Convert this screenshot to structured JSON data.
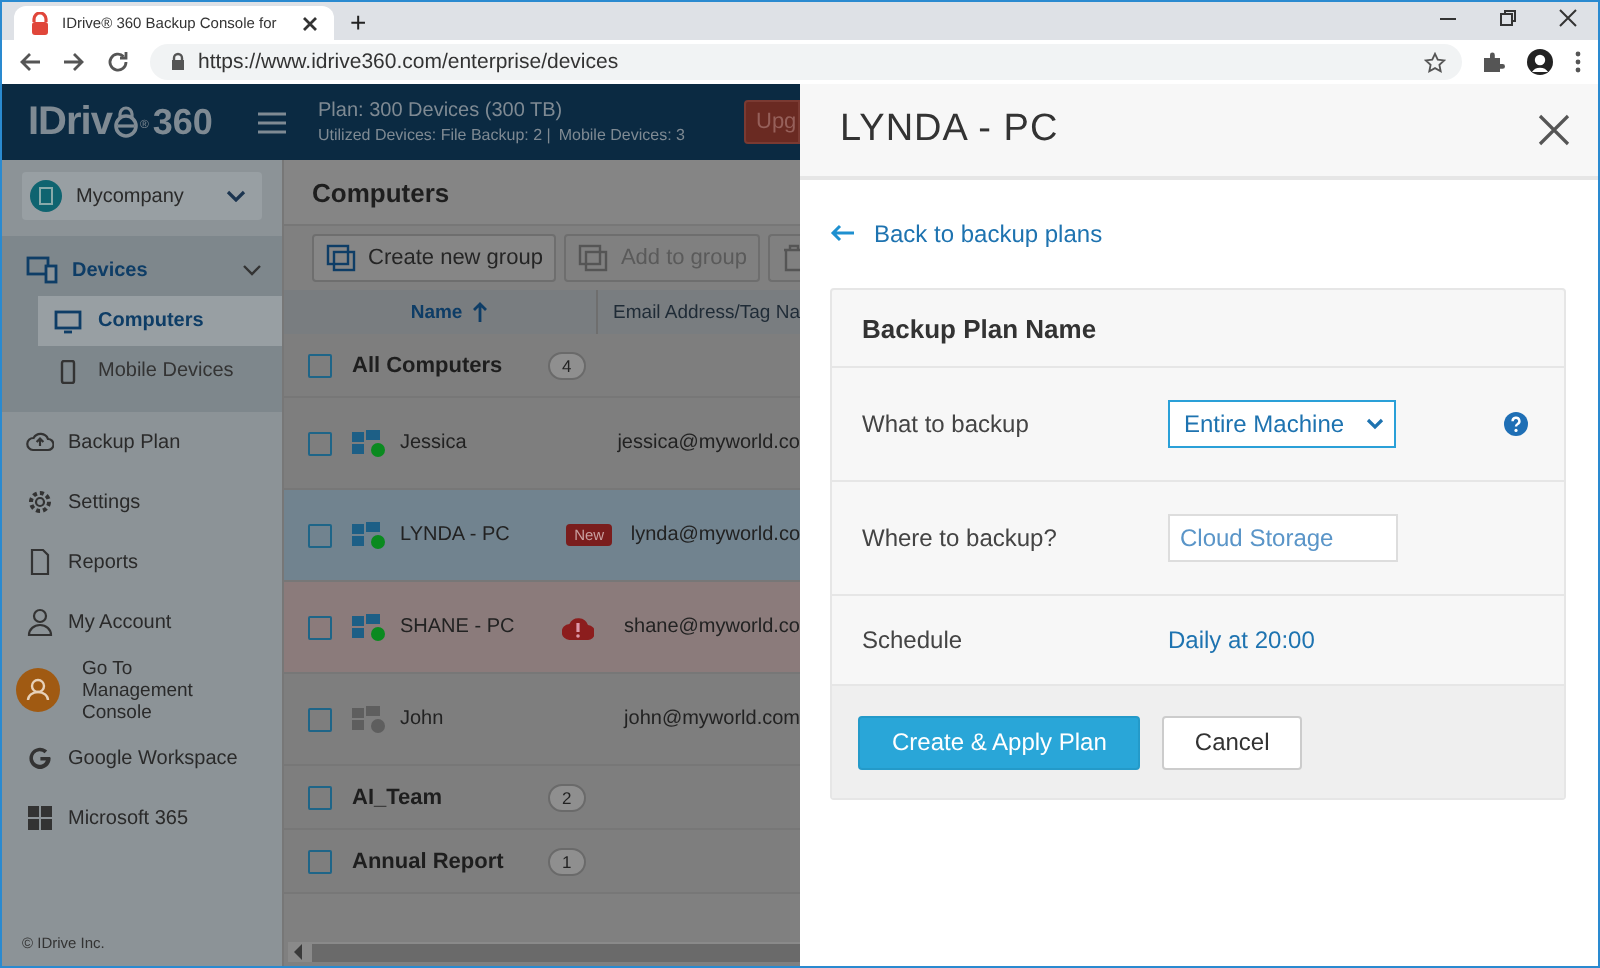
{
  "browser": {
    "tab_title": "IDrive® 360 Backup Console for",
    "new_tab": "+",
    "url": "https://www.idrive360.com/enterprise/devices"
  },
  "header": {
    "logo": {
      "name": "IDriv",
      "mark": "®",
      "number": "360"
    },
    "plan": "Plan: 300 Devices (300 TB)",
    "usage": "Utilized Devices: File Backup: 2 |",
    "mobile": "Mobile Devices: 3",
    "upgrade": "Upg"
  },
  "sidebar": {
    "company": "Mycompany",
    "items": [
      {
        "kind": "section",
        "label": "Devices",
        "expanded": true,
        "children": [
          {
            "label": "Computers",
            "selected": true
          },
          {
            "label": "Mobile Devices",
            "selected": false
          }
        ]
      },
      {
        "kind": "item",
        "label": "Backup Plan"
      },
      {
        "kind": "item",
        "label": "Settings"
      },
      {
        "kind": "item",
        "label": "Reports"
      },
      {
        "kind": "item",
        "label": "My Account"
      },
      {
        "kind": "console",
        "label": "Go To",
        "sublabel": "Management Console"
      },
      {
        "kind": "item",
        "label": "Google Workspace"
      },
      {
        "kind": "item",
        "label": "Microsoft 365"
      }
    ],
    "footer": "© IDrive Inc."
  },
  "content": {
    "title": "Computers",
    "toolbar": [
      {
        "label": "Create new group",
        "disabled": false
      },
      {
        "label": "Add to group",
        "disabled": true
      },
      {
        "disabled": true
      }
    ],
    "columns": [
      {
        "label": "Name",
        "sorted": true
      },
      {
        "label": "Email Address/Tag Na",
        "sorted": false
      }
    ],
    "rows": [
      {
        "kind": "group",
        "name": "All Computers",
        "count": "4",
        "checked": false
      },
      {
        "kind": "device",
        "name": "Jessica",
        "email": "jessica@myworld.co",
        "online": true,
        "selected": false,
        "alert": false,
        "checked": false
      },
      {
        "kind": "device",
        "name": "LYNDA - PC",
        "email": "lynda@myworld.co",
        "online": true,
        "selected": true,
        "alert": false,
        "badge": "New",
        "checked": false
      },
      {
        "kind": "device",
        "name": "SHANE - PC",
        "email": "shane@myworld.co",
        "online": true,
        "selected": false,
        "alert": true,
        "checked": false
      },
      {
        "kind": "device",
        "name": "John",
        "email": "john@myworld.com",
        "online": false,
        "selected": false,
        "alert": false,
        "checked": false
      },
      {
        "kind": "group",
        "name": "AI_Team",
        "count": "2",
        "checked": false
      },
      {
        "kind": "group",
        "name": "Annual Report",
        "count": "1",
        "checked": false
      }
    ]
  },
  "panel": {
    "title": "LYNDA - PC",
    "back": "Back to backup plans",
    "card_title": "Backup Plan Name",
    "fields": [
      {
        "kind": "select",
        "label": "What to backup",
        "value": "Entire Machine",
        "help": true
      },
      {
        "kind": "input",
        "label": "Where to backup?",
        "value": "Cloud Storage",
        "help": false
      },
      {
        "kind": "link",
        "label": "Schedule",
        "value": "Daily at 20:00",
        "help": false
      }
    ],
    "buttons": [
      {
        "kind": "primary",
        "label": "Create & Apply Plan"
      },
      {
        "kind": "secondary",
        "label": "Cancel"
      }
    ]
  }
}
